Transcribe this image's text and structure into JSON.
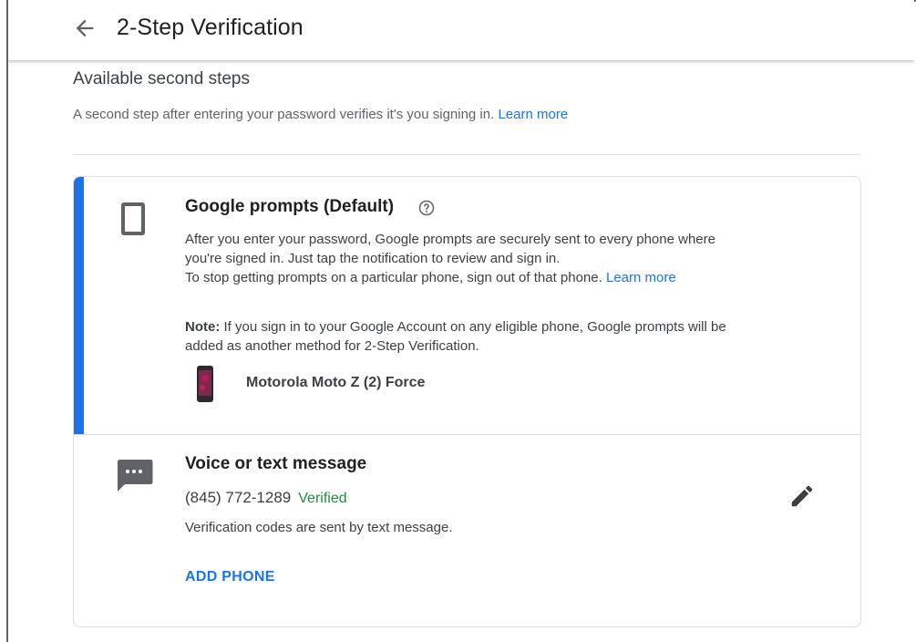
{
  "header": {
    "title": "2-Step Verification",
    "back_icon": "arrow-back-icon"
  },
  "section": {
    "title": "Available second steps",
    "description": "A second step after entering your password verifies it's you signing in.",
    "learn_more": "Learn more"
  },
  "google_prompts": {
    "icon": "phone-outline-icon",
    "title": "Google prompts (Default)",
    "help_icon": "help-circle-icon",
    "desc_line1": "After you enter your password, Google prompts are securely sent to every phone where",
    "desc_line2": "you're signed in. Just tap the notification to review and sign in.",
    "desc_line3": "To stop getting prompts on a particular phone, sign out of that phone.",
    "learn_more": "Learn more",
    "note_label": "Note:",
    "note_line1": "If you sign in to your Google Account on any eligible phone, Google prompts will be",
    "note_line2": "added as another method for 2-Step Verification.",
    "device_name": "Motorola Moto Z (2) Force"
  },
  "voice_text": {
    "icon": "sms-chat-icon",
    "title": "Voice or text message",
    "phone_number": "(845) 772-1289",
    "status": "Verified",
    "description": "Verification codes are sent by text message.",
    "add_phone": "ADD PHONE",
    "edit_icon": "pencil-edit-icon"
  },
  "colors": {
    "accent": "#1a73e8",
    "verified": "#1e8e3e",
    "divider": "#dadce0"
  }
}
